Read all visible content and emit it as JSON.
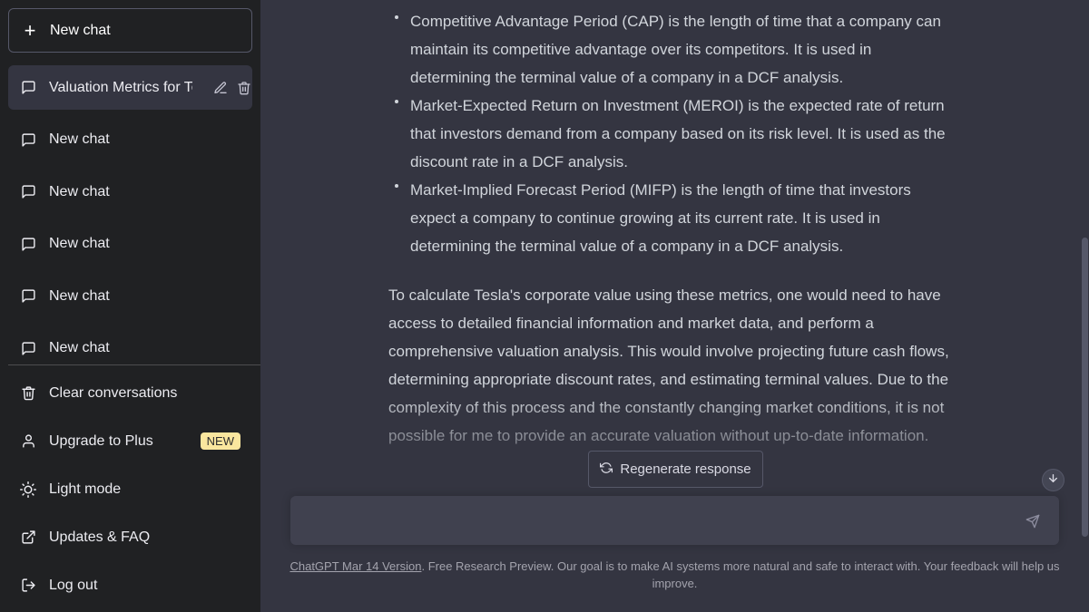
{
  "sidebar": {
    "new_chat_label": "New chat",
    "conversations": [
      {
        "label": "Valuation Metrics for Te",
        "active": true
      },
      {
        "label": "New chat"
      },
      {
        "label": "New chat"
      },
      {
        "label": "New chat"
      },
      {
        "label": "New chat"
      },
      {
        "label": "New chat"
      }
    ],
    "menu": {
      "clear": "Clear conversations",
      "upgrade": "Upgrade to Plus",
      "upgrade_badge": "NEW",
      "light_mode": "Light mode",
      "updates": "Updates & FAQ",
      "logout": "Log out"
    }
  },
  "main": {
    "bullets": [
      "Competitive Advantage Period (CAP) is the length of time that a company can maintain its competitive advantage over its competitors. It is used in determining the terminal value of a company in a DCF analysis.",
      "Market-Expected Return on Investment (MEROI) is the expected rate of return that investors demand from a company based on its risk level. It is used as the discount rate in a DCF analysis.",
      "Market-Implied Forecast Period (MIFP) is the length of time that investors expect a company to continue growing at its current rate. It is used in determining the terminal value of a company in a DCF analysis."
    ],
    "paragraph": "To calculate Tesla's corporate value using these metrics, one would need to have access to detailed financial information and market data, and perform a comprehensive valuation analysis. This would involve projecting future cash flows, determining appropriate discount rates, and estimating terminal values. Due to the complexity of this process and the constantly changing market conditions, it is not possible for me to provide an accurate valuation without up-to-date information.",
    "regenerate_label": "Regenerate response",
    "input_placeholder": "",
    "footer_link": "ChatGPT Mar 14 Version",
    "footer_text": ". Free Research Preview. Our goal is to make AI systems more natural and safe to interact with. Your feedback will help us improve."
  },
  "colors": {
    "sidebar_bg": "#202123",
    "main_bg": "#343541",
    "input_bg": "#40414f",
    "badge_bg": "#fae69e"
  }
}
